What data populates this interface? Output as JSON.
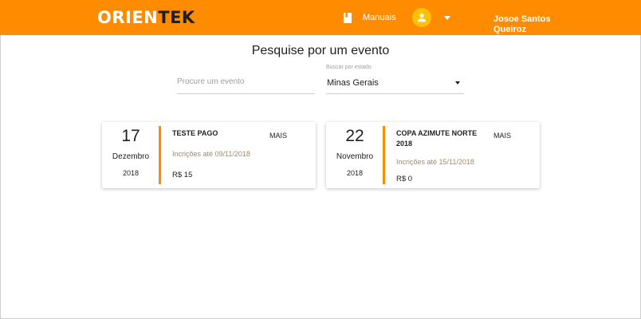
{
  "header": {
    "logo_part1": "ORIEN",
    "logo_part2": "TEK",
    "manuals_label": "Manuais",
    "user_name": "Josoe Santos Queiroz",
    "accent_color": "#ff8c00",
    "avatar_color": "#ffc107"
  },
  "search": {
    "title": "Pesquise por um evento",
    "event_placeholder": "Procure um evento",
    "state_label": "Buscar por estado",
    "state_value": "Minas Gerais"
  },
  "events": [
    {
      "day": "17",
      "month": "Dezembro",
      "year": "2018",
      "name": "TESTE PAGO",
      "more_label": "MAIS",
      "deadline": "Incrições até 09/11/2018",
      "price": "R$ 15"
    },
    {
      "day": "22",
      "month": "Novembro",
      "year": "2018",
      "name": "COPA AZIMUTE NORTE 2018",
      "more_label": "MAIS",
      "deadline": "Incrições até 15/11/2018",
      "price": "R$ 0"
    }
  ],
  "icons": {
    "manuals": "book-icon",
    "user": "person-icon",
    "user_menu": "caret-down-icon",
    "state_select": "caret-down-icon"
  }
}
